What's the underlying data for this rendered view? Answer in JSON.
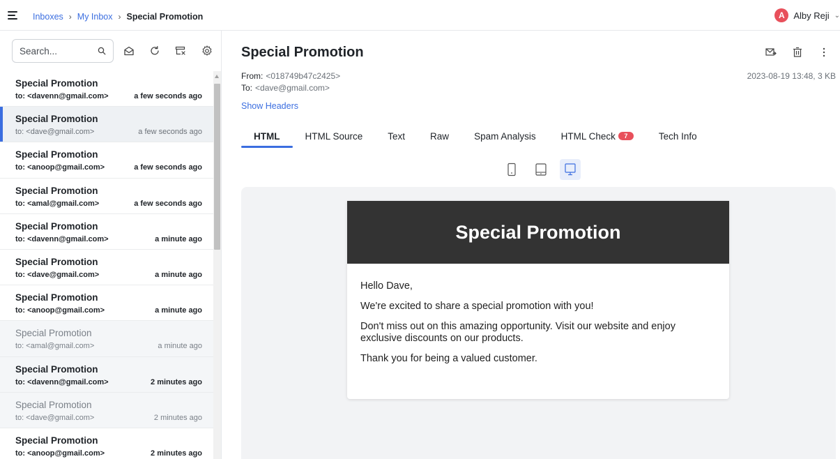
{
  "breadcrumb": {
    "inboxes": "Inboxes",
    "my_inbox": "My Inbox",
    "current": "Special Promotion"
  },
  "user": {
    "initial": "A",
    "name": "Alby Reji",
    "avatar_color": "#e8505b"
  },
  "search": {
    "placeholder": "Search..."
  },
  "messages": [
    {
      "subject": "Special Promotion",
      "to": "to: <davenn@gmail.com>",
      "time": "a few seconds ago",
      "state": "unread"
    },
    {
      "subject": "Special Promotion",
      "to": "to: <dave@gmail.com>",
      "time": "a few seconds ago",
      "state": "selected"
    },
    {
      "subject": "Special Promotion",
      "to": "to: <anoop@gmail.com>",
      "time": "a few seconds ago",
      "state": "unread"
    },
    {
      "subject": "Special Promotion",
      "to": "to: <amal@gmail.com>",
      "time": "a few seconds ago",
      "state": "unread"
    },
    {
      "subject": "Special Promotion",
      "to": "to: <davenn@gmail.com>",
      "time": "a minute ago",
      "state": "unread"
    },
    {
      "subject": "Special Promotion",
      "to": "to: <dave@gmail.com>",
      "time": "a minute ago",
      "state": "unread"
    },
    {
      "subject": "Special Promotion",
      "to": "to: <anoop@gmail.com>",
      "time": "a minute ago",
      "state": "unread"
    },
    {
      "subject": "Special Promotion",
      "to": "to: <amal@gmail.com>",
      "time": "a minute ago",
      "state": "read"
    },
    {
      "subject": "Special Promotion",
      "to": "to: <davenn@gmail.com>",
      "time": "2 minutes ago",
      "state": "unread-alt"
    },
    {
      "subject": "Special Promotion",
      "to": "to: <dave@gmail.com>",
      "time": "2 minutes ago",
      "state": "read"
    },
    {
      "subject": "Special Promotion",
      "to": "to: <anoop@gmail.com>",
      "time": "2 minutes ago",
      "state": "unread"
    }
  ],
  "email": {
    "subject": "Special Promotion",
    "from_label": "From:",
    "from_value": "<018749b47c2425>",
    "to_label": "To:",
    "to_value": "<dave@gmail.com>",
    "meta": "2023-08-19 13:48, 3 KB",
    "show_headers": "Show Headers"
  },
  "tabs": [
    {
      "label": "HTML",
      "active": true
    },
    {
      "label": "HTML Source",
      "active": false
    },
    {
      "label": "Text",
      "active": false
    },
    {
      "label": "Raw",
      "active": false
    },
    {
      "label": "Spam Analysis",
      "active": false
    },
    {
      "label": "HTML Check",
      "active": false,
      "badge": "7"
    },
    {
      "label": "Tech Info",
      "active": false
    }
  ],
  "preview": {
    "header_title": "Special Promotion",
    "greeting": "Hello Dave,",
    "line1": "We're excited to share a special promotion with you!",
    "line2": "Don't miss out on this amazing opportunity. Visit our website and enjoy exclusive discounts on our products.",
    "line3": "Thank you for being a valued customer."
  },
  "colors": {
    "accent": "#3b6ee0",
    "badge": "#e8505b",
    "email_header": "#333333"
  }
}
